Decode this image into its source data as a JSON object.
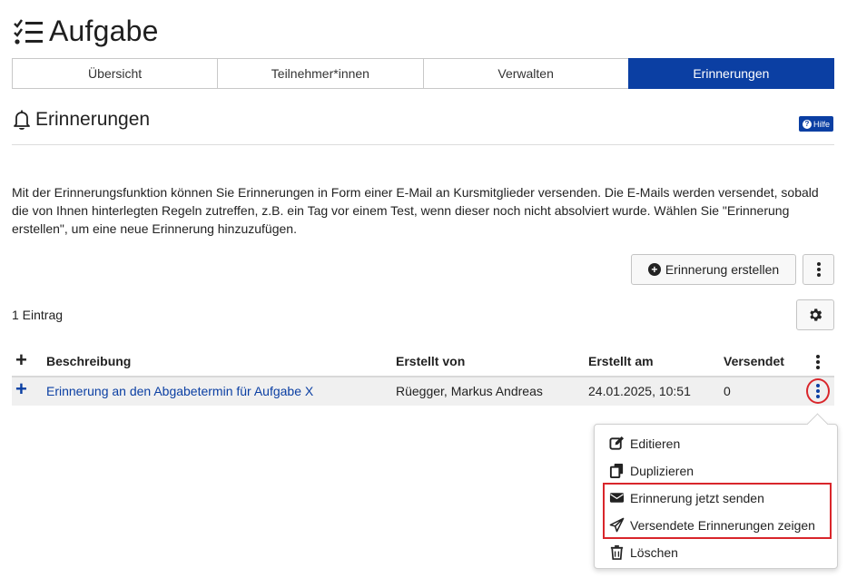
{
  "header": {
    "title": "Aufgabe",
    "icon": "checklist-icon"
  },
  "tabs": [
    {
      "label": "Übersicht",
      "active": false
    },
    {
      "label": "Teilnehmer*innen",
      "active": false
    },
    {
      "label": "Verwalten",
      "active": false
    },
    {
      "label": "Erinnerungen",
      "active": true
    }
  ],
  "section": {
    "title": "Erinnerungen",
    "help_label": "Hilfe",
    "help_icon": "question-circle-icon"
  },
  "description": "Mit der Erinnerungsfunktion können Sie Erinnerungen in Form einer E-Mail an Kursmitglieder versenden. Die E-Mails werden versendet, sobald die von Ihnen hinterlegten Regeln zutreffen, z.B. ein Tag vor einem Test, wenn dieser noch nicht absolviert wurde. Wählen Sie \"Erinnerung erstellen\", um eine neue Erinnerung hinzuzufügen.",
  "toolbar": {
    "create_label": "Erinnerung erstellen"
  },
  "table": {
    "count_label": "1 Eintrag",
    "columns": [
      "Beschreibung",
      "Erstellt von",
      "Erstellt am",
      "Versendet"
    ],
    "rows": [
      {
        "description": "Erinnerung an den Abgabetermin für Aufgabe X",
        "created_by": "Rüegger, Markus Andreas",
        "created_at": "24.01.2025, 10:51",
        "sent": "0"
      }
    ]
  },
  "menu": {
    "items": [
      {
        "label": "Editieren",
        "icon": "edit-icon"
      },
      {
        "label": "Duplizieren",
        "icon": "copy-icon"
      },
      {
        "label": "Erinnerung jetzt senden",
        "icon": "envelope-icon"
      },
      {
        "label": "Versendete Erinnerungen zeigen",
        "icon": "paper-plane-icon"
      },
      {
        "label": "Löschen",
        "icon": "trash-icon"
      }
    ]
  },
  "colors": {
    "accent": "#0b3fa3",
    "highlight": "#d9262b"
  }
}
